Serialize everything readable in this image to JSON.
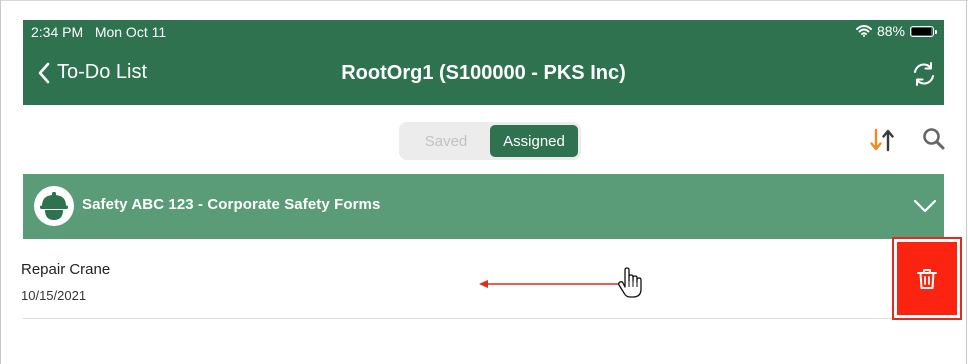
{
  "status_bar": {
    "time": "2:34 PM",
    "date": "Mon Oct 11",
    "battery": "88%",
    "battery_level": 0.88
  },
  "nav": {
    "back_label": "To-Do List",
    "title": "RootOrg1 (S100000 - PKS Inc)"
  },
  "tabs": {
    "saved": "Saved",
    "assigned": "Assigned",
    "selected": "Assigned"
  },
  "section": {
    "title": "Safety ABC 123 - Corporate Safety Forms",
    "expanded": true
  },
  "items": [
    {
      "title": "Repair Crane",
      "date": "10/15/2021"
    }
  ],
  "colors": {
    "header_green": "#2e7250",
    "section_green": "#5a9b78",
    "delete_red": "#fb2410",
    "sort_orange": "#f08a1c",
    "annotation_red": "#e02b1f"
  },
  "icons": {
    "back": "chevron-left-icon",
    "refresh": "refresh-icon",
    "sort": "sort-icon",
    "search": "search-icon",
    "section": "hard-hat-icon",
    "expand": "chevron-down-icon",
    "delete": "trash-icon"
  }
}
